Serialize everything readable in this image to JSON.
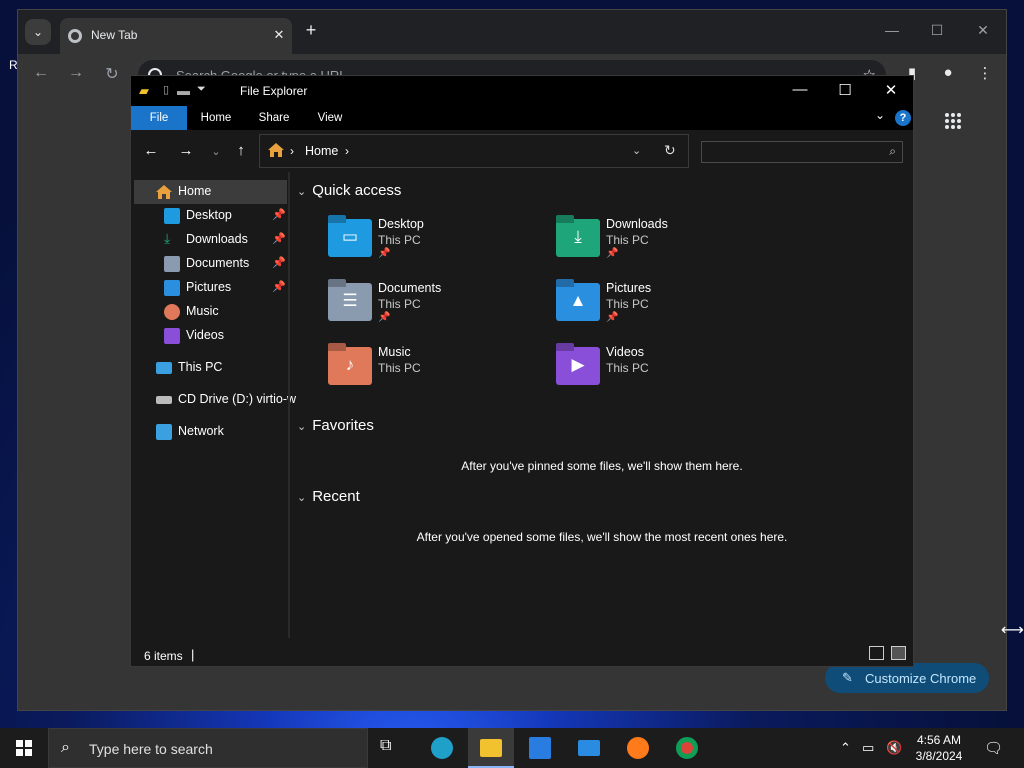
{
  "desktop": {
    "partial_label": "R"
  },
  "chrome": {
    "tab_title": "New Tab",
    "tab_close": "✕",
    "new_tab": "+",
    "omnibox_placeholder": "Search Google or type a URL",
    "customize_label": "Customize Chrome",
    "accent_color": "#0f4c77"
  },
  "explorer": {
    "title": "File Explorer",
    "ribbon_tabs": [
      "File",
      "Home",
      "Share",
      "View"
    ],
    "address": {
      "location": "Home",
      "sep": "›"
    },
    "nav": {
      "home": "Home",
      "desktop": "Desktop",
      "downloads": "Downloads",
      "documents": "Documents",
      "pictures": "Pictures",
      "music": "Music",
      "videos": "Videos",
      "this_pc": "This PC",
      "cd_drive": "CD Drive (D:) virtio-w",
      "network": "Network"
    },
    "groups": {
      "quick_access": "Quick access",
      "favorites": "Favorites",
      "recent": "Recent"
    },
    "tiles": [
      {
        "name": "Desktop",
        "location": "This PC",
        "pinned": true,
        "icon": "desktop-folder-icon",
        "color": "#1e9be0"
      },
      {
        "name": "Downloads",
        "location": "This PC",
        "pinned": true,
        "icon": "downloads-folder-icon",
        "color": "#1fa57a"
      },
      {
        "name": "Documents",
        "location": "This PC",
        "pinned": true,
        "icon": "documents-folder-icon",
        "color": "#8a9bb0"
      },
      {
        "name": "Pictures",
        "location": "This PC",
        "pinned": true,
        "icon": "pictures-folder-icon",
        "color": "#2b8fe0"
      },
      {
        "name": "Music",
        "location": "This PC",
        "pinned": false,
        "icon": "music-folder-icon",
        "color": "#e0785a"
      },
      {
        "name": "Videos",
        "location": "This PC",
        "pinned": false,
        "icon": "videos-folder-icon",
        "color": "#8a4fd8"
      }
    ],
    "favorites_empty": "After you've pinned some files, we'll show them here.",
    "recent_empty": "After you've opened some files, we'll show the most recent ones here.",
    "status": "6 items",
    "status_sep": "|"
  },
  "taskbar": {
    "search_placeholder": "Type here to search",
    "time": "4:56 AM",
    "date": "3/8/2024"
  }
}
